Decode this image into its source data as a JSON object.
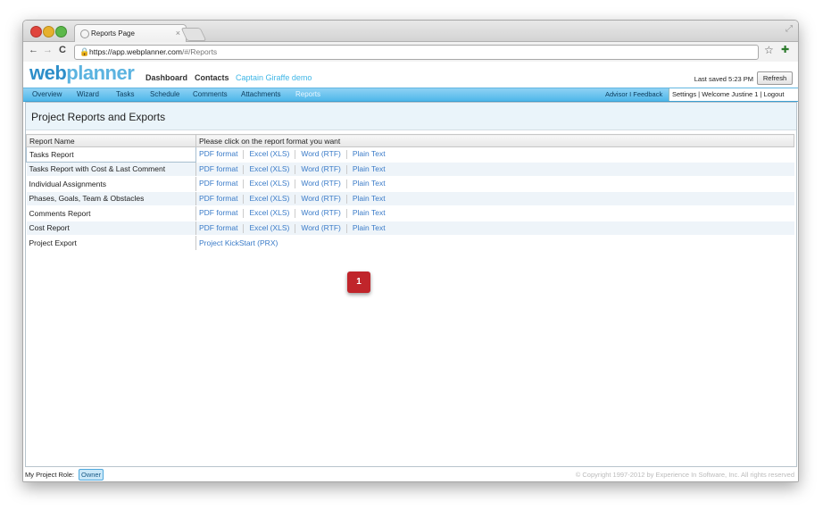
{
  "browser": {
    "tab_title": "Reports Page",
    "tab_close": "×",
    "url_host": "https://app.webplanner.com",
    "url_path": "/#/Reports",
    "back": "←",
    "forward": "→",
    "reload": "C",
    "star": "☆",
    "resize": "⤢"
  },
  "brand": {
    "logo_main": "web",
    "logo_accent": "planner"
  },
  "topnav": {
    "dashboard": "Dashboard",
    "contacts": "Contacts",
    "project": "Captain Giraffe demo"
  },
  "status": {
    "last_saved": "Last saved 5:23 PM",
    "refresh": "Refresh"
  },
  "menu": {
    "items": [
      "Overview",
      "Wizard",
      "Tasks",
      "Schedule",
      "Comments",
      "Attachments",
      "Reports"
    ],
    "advisor_feedback": "Advisor I Feedback",
    "user_links": "Settings  |  Welcome Justine 1  |  Logout"
  },
  "page_title": "Project Reports and Exports",
  "table": {
    "headers": [
      "Report Name",
      "Please click on the report format you want"
    ],
    "rows": [
      {
        "name": "Tasks Report",
        "formats": [
          "PDF format",
          "Excel (XLS)",
          "Word (RTF)",
          "Plain Text"
        ]
      },
      {
        "name": "Tasks Report with Cost & Last Comment",
        "formats": [
          "PDF format",
          "Excel (XLS)",
          "Word (RTF)",
          "Plain Text"
        ]
      },
      {
        "name": "Individual Assignments",
        "formats": [
          "PDF format",
          "Excel (XLS)",
          "Word (RTF)",
          "Plain Text"
        ]
      },
      {
        "name": "Phases, Goals, Team & Obstacles",
        "formats": [
          "PDF format",
          "Excel (XLS)",
          "Word (RTF)",
          "Plain Text"
        ]
      },
      {
        "name": "Comments Report",
        "formats": [
          "PDF format",
          "Excel (XLS)",
          "Word (RTF)",
          "Plain Text"
        ]
      },
      {
        "name": "Cost Report",
        "formats": [
          "PDF format",
          "Excel (XLS)",
          "Word (RTF)",
          "Plain Text"
        ]
      },
      {
        "name": "Project Export",
        "formats": [
          "Project KickStart (PRX)"
        ]
      }
    ]
  },
  "annotation_badge": "1",
  "footer": {
    "role_label": "My Project Role:",
    "role_value": "Owner",
    "copyright": "© Copyright 1997-2012 by Experience In Software, Inc. All rights reserved"
  },
  "colors": {
    "accent": "#3fb6e6",
    "menubar": "#4fb7ea",
    "link": "#3a7bc8",
    "badge": "#c0252b"
  }
}
